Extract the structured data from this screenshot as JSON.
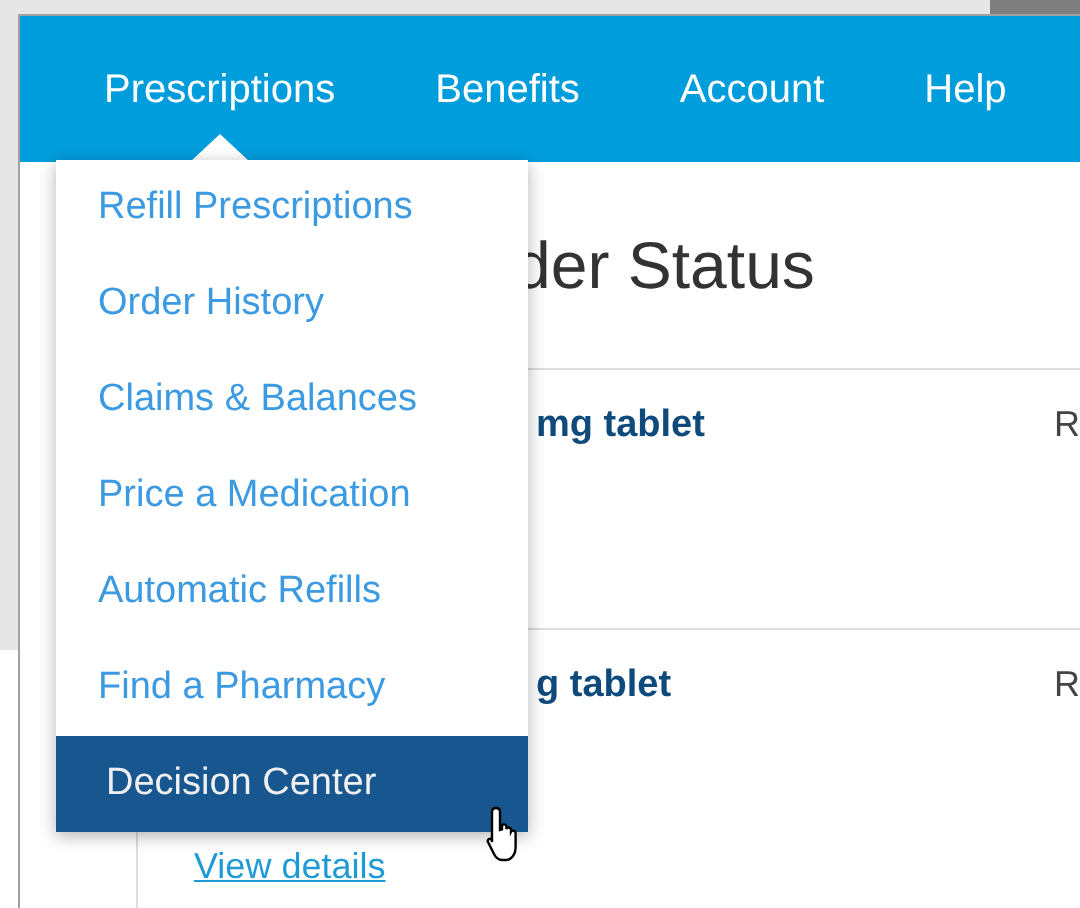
{
  "nav": {
    "items": [
      {
        "label": "Prescriptions",
        "selected": true
      },
      {
        "label": "Benefits",
        "selected": false
      },
      {
        "label": "Account",
        "selected": false
      },
      {
        "label": "Help",
        "selected": false
      }
    ]
  },
  "menu": {
    "items": [
      {
        "label": "Refill Prescriptions",
        "selected": false
      },
      {
        "label": "Order History",
        "selected": false
      },
      {
        "label": "Claims & Balances",
        "selected": false
      },
      {
        "label": "Price a Medication",
        "selected": false
      },
      {
        "label": "Automatic Refills",
        "selected": false
      },
      {
        "label": "Find a Pharmacy",
        "selected": false
      },
      {
        "label": "Decision Center",
        "selected": true
      }
    ]
  },
  "page": {
    "heading": "der Status",
    "orders": [
      {
        "drug": "mg tablet",
        "column_2": "R"
      },
      {
        "drug": "g tablet",
        "column_2": "R",
        "link": "View details"
      }
    ]
  }
}
